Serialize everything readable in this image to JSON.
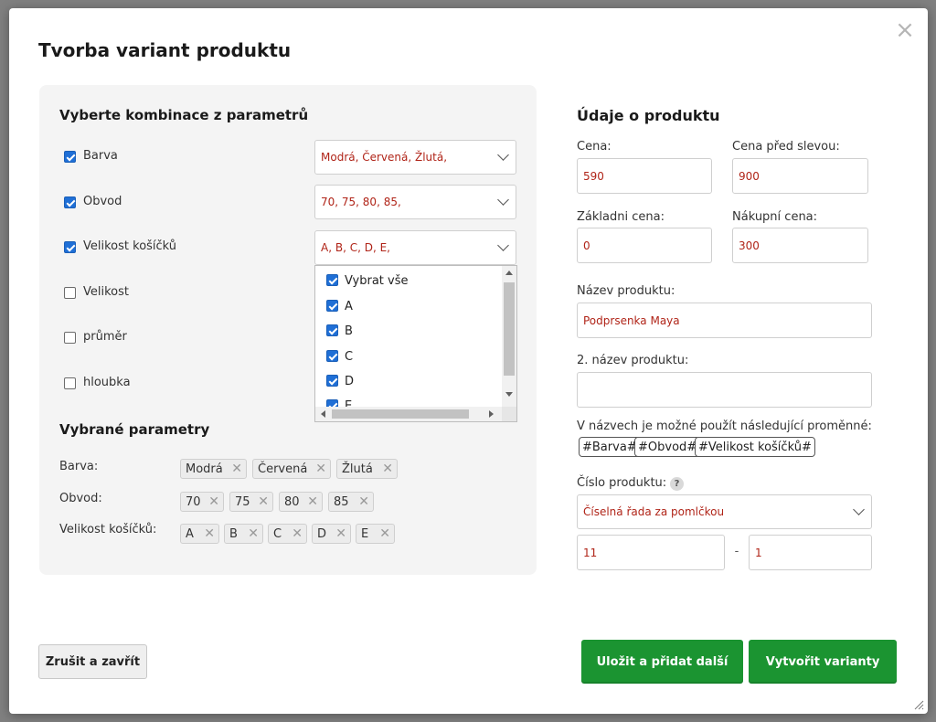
{
  "dialog": {
    "title": "Tvorba variant produktu",
    "close_icon": "close-icon"
  },
  "params": {
    "heading": "Vyberte kombinace z parametrů",
    "items": [
      {
        "label": "Barva",
        "checked": true,
        "value": "Modrá, Červená, Žlutá,"
      },
      {
        "label": "Obvod",
        "checked": true,
        "value": "70, 75, 80, 85,"
      },
      {
        "label": "Velikost košíčků",
        "checked": true,
        "value": "A, B, C, D, E,"
      },
      {
        "label": "Velikost",
        "checked": false
      },
      {
        "label": "průměr",
        "checked": false
      },
      {
        "label": "hloubka",
        "checked": false
      }
    ]
  },
  "dropdown": {
    "options": [
      {
        "label": "Vybrat vše",
        "checked": true
      },
      {
        "label": "A",
        "checked": true
      },
      {
        "label": "B",
        "checked": true
      },
      {
        "label": "C",
        "checked": true
      },
      {
        "label": "D",
        "checked": true
      },
      {
        "label": "E",
        "checked": true
      }
    ]
  },
  "selected": {
    "heading": "Vybrané parametry",
    "rows": [
      {
        "label": "Barva:",
        "tags": [
          "Modrá",
          "Červená",
          "Žlutá"
        ]
      },
      {
        "label": "Obvod:",
        "tags": [
          "70",
          "75",
          "80",
          "85"
        ]
      },
      {
        "label": "Velikost košíčků:",
        "tags": [
          "A",
          "B",
          "C",
          "D",
          "E"
        ]
      }
    ]
  },
  "product": {
    "heading": "Údaje o produktu",
    "price_label": "Cena:",
    "price_value": "590",
    "old_price_label": "Cena před slevou:",
    "old_price_value": "900",
    "base_price_label": "Základni cena:",
    "base_price_value": "0",
    "purchase_price_label": "Nákupní cena:",
    "purchase_price_value": "300",
    "name_label": "Název produktu:",
    "name_value": "Podprsenka Maya",
    "name2_label": "2. název produktu:",
    "name2_value": "",
    "vars_note": "V názvech je možné použít následující proměnné:",
    "vars": [
      "#Barva#",
      "#Obvod#",
      "#Velikost košíčků#"
    ],
    "number_label": "Číslo produktu:",
    "help_glyph": "?",
    "number_mode": "Číselná řada za pomlčkou",
    "number_start": "11",
    "separator": "-",
    "number_step": "1"
  },
  "buttons": {
    "cancel": "Zrušit a zavřít",
    "save_add": "Uložit a přidat další",
    "create": "Vytvořit varianty"
  },
  "colors": {
    "accent_green": "#1b9431",
    "value_red": "#b02418",
    "checkbox_blue": "#1f6fd6"
  }
}
